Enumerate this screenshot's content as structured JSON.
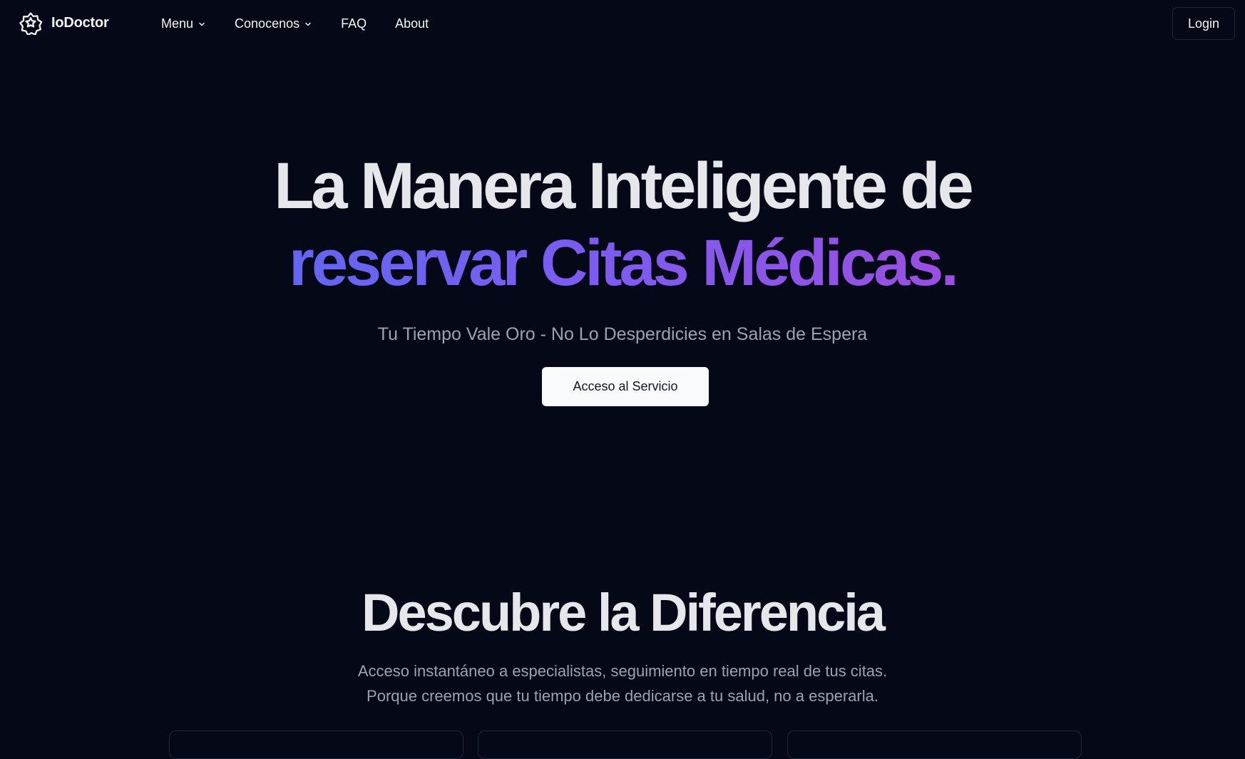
{
  "brand": {
    "name": "IoDoctor",
    "icon": "star-badge-icon"
  },
  "nav": {
    "menu_label": "Menu",
    "conocenos_label": "Conocenos",
    "faq_label": "FAQ",
    "about_label": "About",
    "dropdown_icon": "chevron-down-icon"
  },
  "header": {
    "login_label": "Login"
  },
  "hero": {
    "line1": "La Manera Inteligente de",
    "line2": "reservar Citas Médicas.",
    "subtitle": "Tu Tiempo Vale Oro - No Lo Desperdicies en Salas de Espera",
    "cta_label": "Acceso al Servicio"
  },
  "features": {
    "title": "Descubre la Diferencia",
    "desc_line1": "Acceso instantáneo a especialistas, seguimiento en tiempo real de tus citas.",
    "desc_line2": "Porque creemos que tu tiempo debe dedicarse a tu salud, no a esperarla."
  },
  "colors": {
    "background": "#050816",
    "gradient_start": "#6366f1",
    "gradient_end": "#9b4fe0",
    "cta_background": "#f9fafb"
  }
}
